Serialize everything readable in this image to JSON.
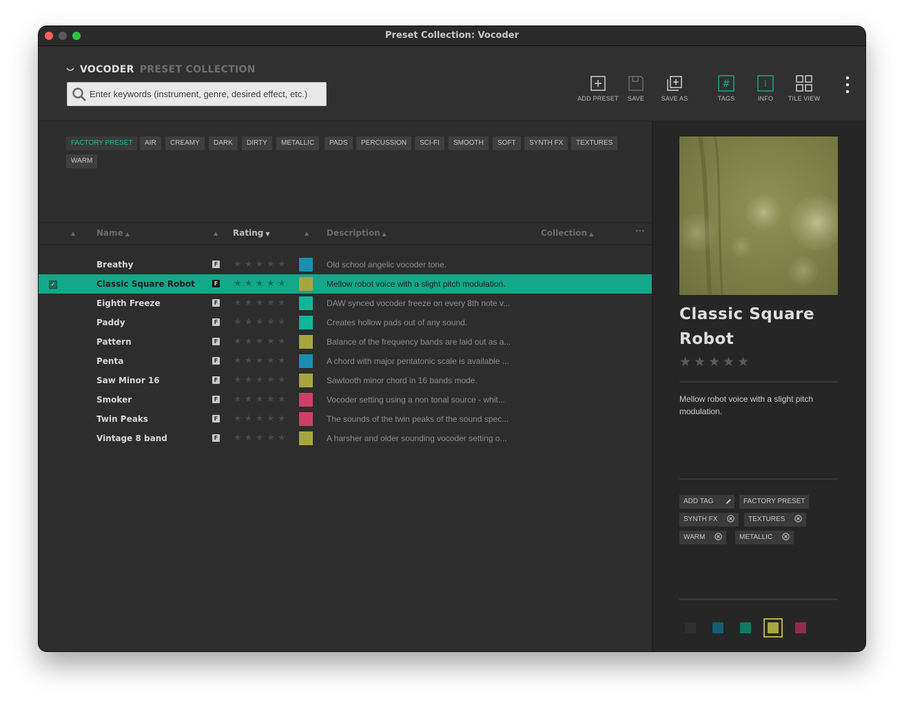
{
  "window": {
    "title": "Preset Collection: Vocoder"
  },
  "header": {
    "brand_primary": "VOCODER",
    "brand_secondary": "PRESET COLLECTION",
    "search_placeholder": "Enter keywords (instrument, genre, desired effect, etc.)",
    "tools": [
      {
        "label": "ADD PRESET",
        "icon": "add-preset-icon"
      },
      {
        "label": "SAVE",
        "icon": "save-icon"
      },
      {
        "label": "SAVE AS",
        "icon": "save-as-icon"
      },
      {
        "label": "TAGS",
        "icon": "tags-icon",
        "active": true
      },
      {
        "label": "INFO",
        "icon": "info-icon",
        "active": true
      },
      {
        "label": "TILE VIEW",
        "icon": "tile-view-icon"
      }
    ]
  },
  "tags": [
    "FACTORY PRESET",
    "AIR",
    "CREAMY",
    "DARK",
    "DIRTY",
    "METALLIC",
    "PADS",
    "PERCUSSION",
    "SCI-FI",
    "SMOOTH",
    "SOFT",
    "SYNTH FX",
    "TEXTURES",
    "WARM"
  ],
  "columns": {
    "name": "Name",
    "rating": "Rating",
    "description": "Description",
    "collection": "Collection",
    "more": "···"
  },
  "presets": [
    {
      "name": "Breathy",
      "badge": "F",
      "color": "#1a8fb0",
      "description": "Old school angelic vocoder tone."
    },
    {
      "name": "Classic Square Robot",
      "badge": "F",
      "color": "#a7a63e",
      "description": "Mellow robot voice with a slight pitch modulation.",
      "selected": true
    },
    {
      "name": "Eighth Freeze",
      "badge": "F",
      "color": "#13b49a",
      "description": "DAW synced vocoder freeze on every 8th note v..."
    },
    {
      "name": "Paddy",
      "badge": "F",
      "color": "#13b49a",
      "description": "Creates hollow pads out of any sound."
    },
    {
      "name": "Pattern",
      "badge": "F",
      "color": "#a7a63e",
      "description": "Balance of the frequency bands are laid out as a..."
    },
    {
      "name": "Penta",
      "badge": "F",
      "color": "#1a8fb0",
      "description": "A chord with major pentatonic scale is available ..."
    },
    {
      "name": "Saw Minor 16",
      "badge": "F",
      "color": "#a7a63e",
      "description": "Sawtooth minor chord in 16 bands mode."
    },
    {
      "name": "Smoker",
      "badge": "F",
      "color": "#cf3f67",
      "description": "Vocoder setting using a non tonal source - whit..."
    },
    {
      "name": "Twin Peaks",
      "badge": "F",
      "color": "#cf3f67",
      "description": "The sounds of the twin peaks of the sound spec..."
    },
    {
      "name": "Vintage 8 band",
      "badge": "F",
      "color": "#a7a63e",
      "description": "A harsher and older sounding vocoder setting  o..."
    }
  ],
  "detail": {
    "title": "Classic Square Robot",
    "description": "Mellow robot voice with a slight pitch modulation.",
    "add_tag_label": "ADD TAG",
    "tags": [
      "FACTORY PRESET",
      "SYNTH FX",
      "TEXTURES",
      "WARM",
      "METALLIC"
    ],
    "color_options": [
      "#2f2f2f",
      "#145f73",
      "#0f7a66",
      "#a7a63e",
      "#8e2f49"
    ],
    "selected_color": "#a7a63e"
  }
}
